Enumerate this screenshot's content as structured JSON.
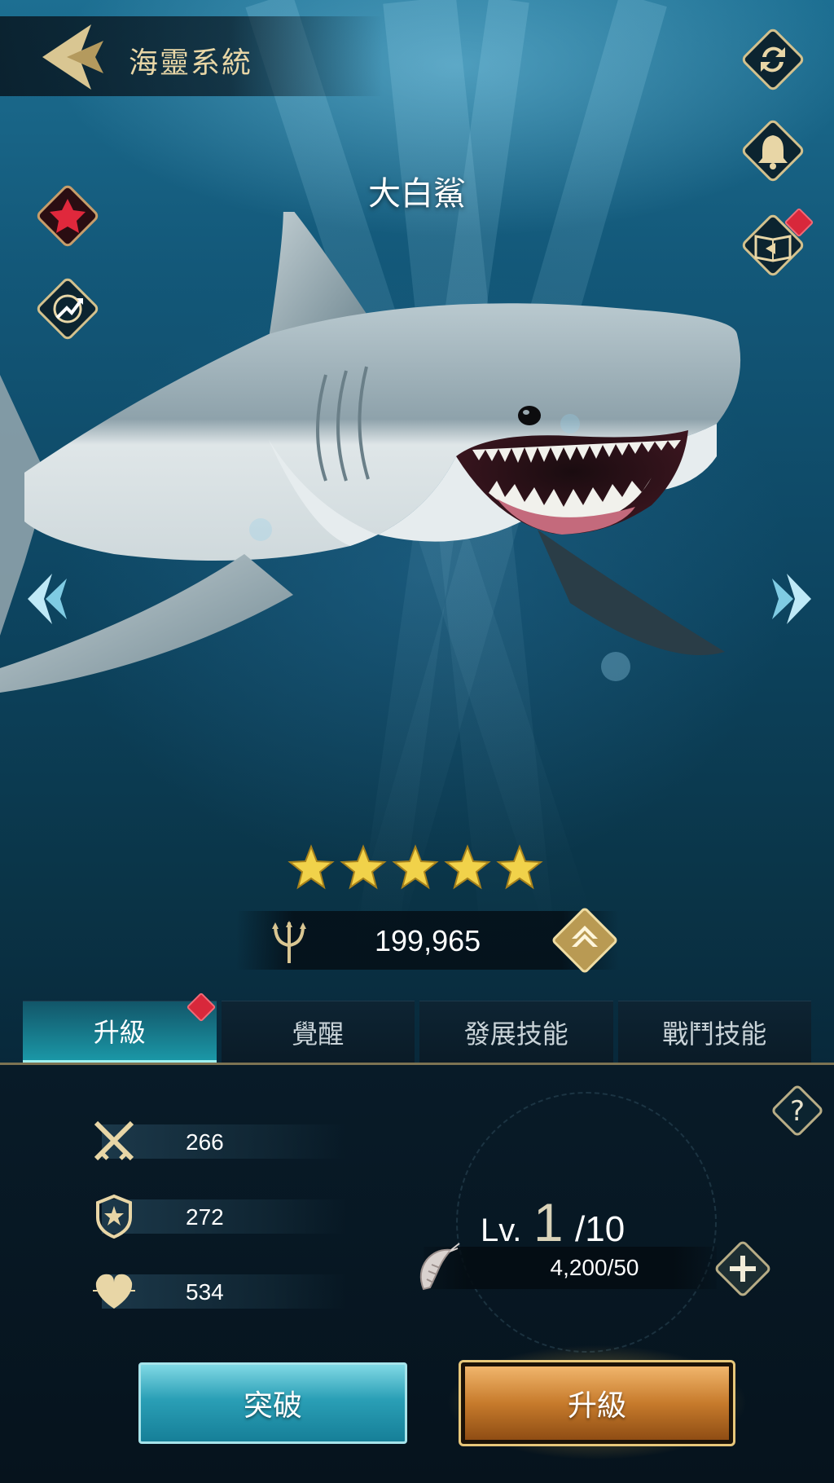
{
  "header": {
    "title": "海靈系統"
  },
  "creature": {
    "name": "大白鯊",
    "stars": 5,
    "power": "199,965"
  },
  "tabs": [
    {
      "label": "升級",
      "active": true,
      "has_notification": true
    },
    {
      "label": "覺醒",
      "active": false,
      "has_notification": false
    },
    {
      "label": "發展技能",
      "active": false,
      "has_notification": false
    },
    {
      "label": "戰鬥技能",
      "active": false,
      "has_notification": false
    }
  ],
  "stats": {
    "attack": "266",
    "defense": "272",
    "health": "534"
  },
  "level": {
    "prefix": "Lv.",
    "current": "1",
    "max": "/10"
  },
  "exp": {
    "value": "4,200/50"
  },
  "buttons": {
    "breakthrough": "突破",
    "upgrade": "升級"
  },
  "icons": {
    "back": "back-arrow-icon",
    "refresh": "refresh-icon",
    "bell": "bell-icon",
    "guide": "book-icon",
    "gem": "red-gem-icon",
    "growth": "growth-icon",
    "attack": "crossed-swords-icon",
    "defense": "shield-icon",
    "health": "heart-icon",
    "power": "trident-icon",
    "exp_item": "shrimp-icon"
  },
  "colors": {
    "accent_gold": "#e8d6a6",
    "tab_active": "#1eaab9",
    "upgrade_orange": "#c77b2c",
    "breakthrough_cyan": "#2a9fb6",
    "notification_red": "#d8283b"
  }
}
